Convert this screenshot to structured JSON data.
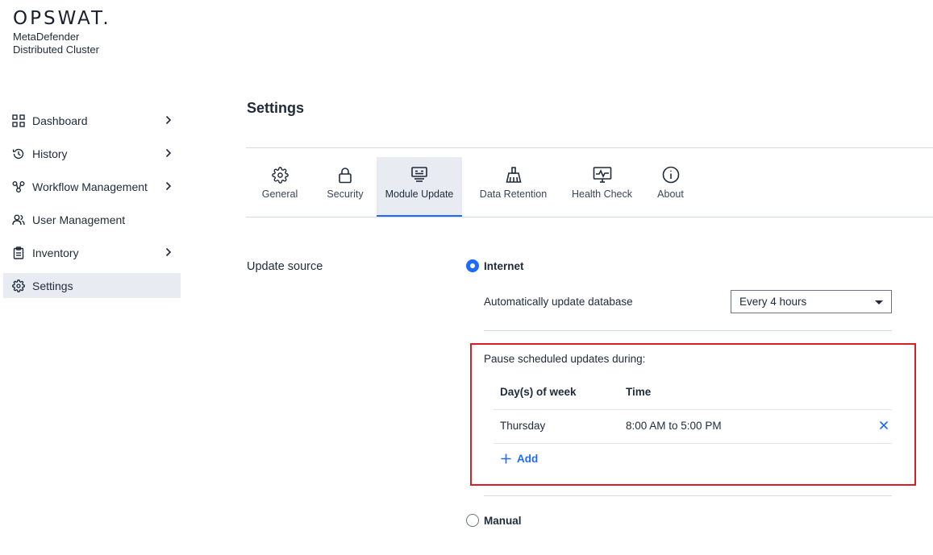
{
  "brand": {
    "logo": "OPSWAT.",
    "product_line1": "MetaDefender",
    "product_line2": "Distributed Cluster"
  },
  "sidebar": {
    "items": [
      {
        "label": "Dashboard",
        "icon": "grid-icon",
        "has_chevron": true,
        "active": false
      },
      {
        "label": "History",
        "icon": "history-icon",
        "has_chevron": true,
        "active": false
      },
      {
        "label": "Workflow Management",
        "icon": "workflow-icon",
        "has_chevron": true,
        "active": false
      },
      {
        "label": "User Management",
        "icon": "users-icon",
        "has_chevron": false,
        "active": false
      },
      {
        "label": "Inventory",
        "icon": "clipboard-icon",
        "has_chevron": true,
        "active": false
      },
      {
        "label": "Settings",
        "icon": "gear-icon",
        "has_chevron": false,
        "active": true
      }
    ]
  },
  "page": {
    "title": "Settings"
  },
  "tabs": [
    {
      "label": "General",
      "icon": "gear-icon",
      "active": false
    },
    {
      "label": "Security",
      "icon": "lock-icon",
      "active": false
    },
    {
      "label": "Module Update",
      "icon": "module-update-icon",
      "active": true
    },
    {
      "label": "Data Retention",
      "icon": "broom-icon",
      "active": false
    },
    {
      "label": "Health Check",
      "icon": "monitor-pulse-icon",
      "active": false
    },
    {
      "label": "About",
      "icon": "info-icon",
      "active": false
    }
  ],
  "update_source": {
    "label": "Update source",
    "internet_label": "Internet",
    "internet_checked": true,
    "auto_update_label": "Automatically update database",
    "auto_update_value": "Every 4 hours",
    "pause_label": "Pause scheduled updates during:",
    "table": {
      "headers": [
        "Day(s) of week",
        "Time"
      ],
      "rows": [
        {
          "day": "Thursday",
          "time": "8:00 AM to 5:00 PM"
        }
      ]
    },
    "add_label": "Add",
    "manual_label": "Manual",
    "manual_checked": false
  },
  "colors": {
    "accent": "#1d6bfc",
    "highlight_border": "#d81f26",
    "active_bg": "#e8ebf2"
  }
}
